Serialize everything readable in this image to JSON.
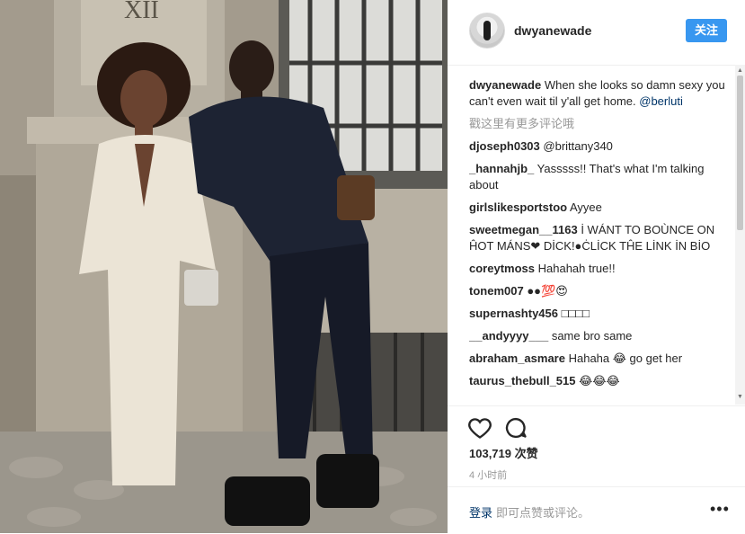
{
  "photo": {
    "sign_text": "XII"
  },
  "header": {
    "username": "dwyanewade",
    "follow_label": "关注"
  },
  "caption": {
    "user": "dwyanewade",
    "text": "When she looks so damn sexy you can't even wait til y'all get home.",
    "mention": "@berluti"
  },
  "more_comments_label": "戳这里有更多评论哦",
  "comments": [
    {
      "user": "djoseph0303",
      "text": "@brittany340"
    },
    {
      "user": "_hannahjb_",
      "text": "Yasssss!! That's what I'm talking about"
    },
    {
      "user": "girlslikesportstoo",
      "text": "Ayyee"
    },
    {
      "user": "sweetmegan__1163",
      "text": "İ WÁNT TO BOÙNCE ON ĤOT MÁNS❤ DİCK!●ĊLİCK TĤE LİNK İN BİO"
    },
    {
      "user": "coreytmoss",
      "text": "Hahahah true!!"
    },
    {
      "user": "tonem007",
      "text": "●●💯😍"
    },
    {
      "user": "supernashty456",
      "text": "□□□□"
    },
    {
      "user": "__andyyyy___",
      "text": "same bro same"
    },
    {
      "user": "abraham_asmare",
      "text": "Hahaha 😂 go get her"
    },
    {
      "user": "taurus_thebull_515",
      "text": "😂😂😂"
    }
  ],
  "actions": {
    "likes": "103,719 次赞",
    "time": "4 小时前"
  },
  "footer": {
    "login_label": "登录",
    "login_text": "即可点赞或评论。",
    "more_label": "•••"
  }
}
